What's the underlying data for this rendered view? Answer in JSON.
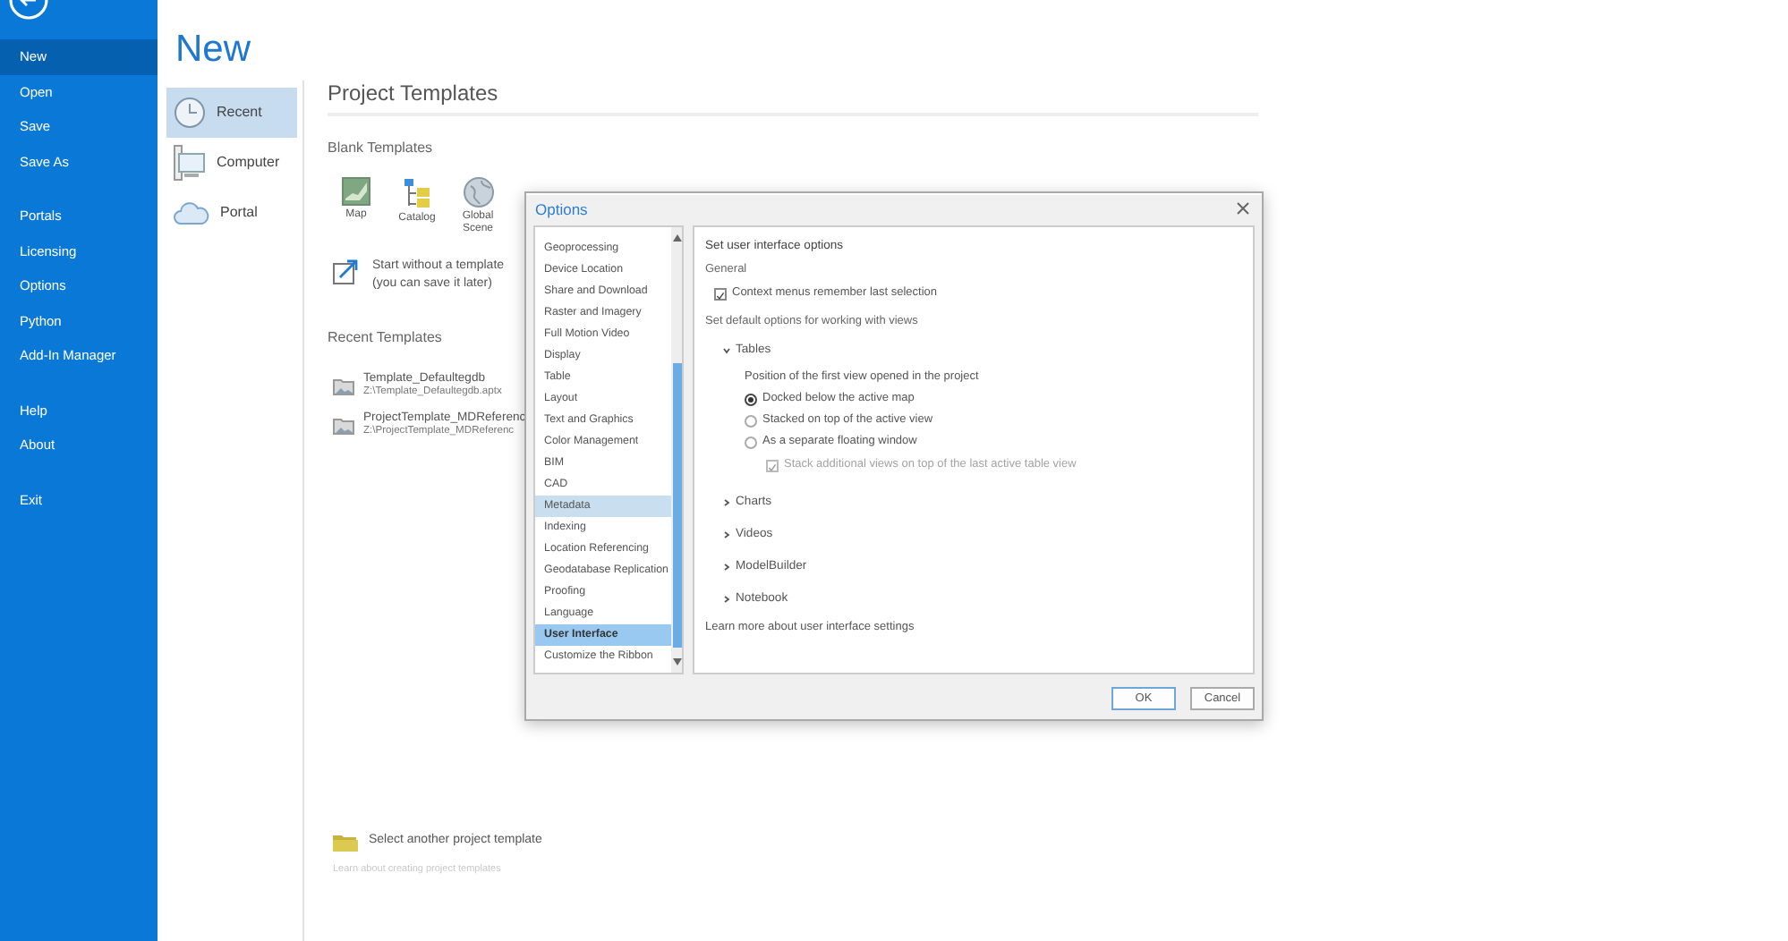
{
  "sidebar": {
    "groups": [
      [
        {
          "label": "New",
          "selected": true
        },
        {
          "label": "Open",
          "selected": false
        },
        {
          "label": "Save",
          "selected": false
        },
        {
          "label": "Save As",
          "selected": false
        }
      ],
      [
        {
          "label": "Portals",
          "selected": false
        },
        {
          "label": "Licensing",
          "selected": false
        },
        {
          "label": "Options",
          "selected": false
        },
        {
          "label": "Python",
          "selected": false
        },
        {
          "label": "Add-In Manager",
          "selected": false
        }
      ],
      [
        {
          "label": "Help",
          "selected": false
        },
        {
          "label": "About",
          "selected": false
        }
      ],
      [
        {
          "label": "Exit",
          "selected": false
        }
      ]
    ]
  },
  "page_title": "New",
  "locations": [
    {
      "label": "Recent",
      "kind": "clock",
      "selected": true
    },
    {
      "label": "Computer",
      "kind": "computer",
      "selected": false
    },
    {
      "label": "Portal",
      "kind": "cloud",
      "selected": false
    }
  ],
  "content": {
    "title": "Project Templates",
    "blank_templates": {
      "heading": "Blank Templates",
      "items": [
        {
          "label": "Map",
          "kind": "map"
        },
        {
          "label": "Catalog",
          "kind": "catalog"
        },
        {
          "label": "Global Scene",
          "kind": "globe"
        }
      ]
    },
    "start_without": [
      "Start without a template",
      "(you can save it later)"
    ],
    "recent_templates": {
      "heading": "Recent Templates",
      "items": [
        {
          "name": "Template_Defaultegdb",
          "path": "Z:\\Template_Defaultegdb.aptx"
        },
        {
          "name": "ProjectTemplate_MDReferenc",
          "path": "Z:\\ProjectTemplate_MDReferenc"
        }
      ]
    },
    "select_another": "Select another project template",
    "learn_link": "Learn about creating project templates"
  },
  "dialog": {
    "title": "Options",
    "categories": [
      {
        "label": "Geoprocessing",
        "selected": false,
        "highlighted": false
      },
      {
        "label": "Device Location",
        "selected": false,
        "highlighted": false
      },
      {
        "label": "Share and Download",
        "selected": false,
        "highlighted": false
      },
      {
        "label": "Raster and Imagery",
        "selected": false,
        "highlighted": false
      },
      {
        "label": "Full Motion Video",
        "selected": false,
        "highlighted": false
      },
      {
        "label": "Display",
        "selected": false,
        "highlighted": false
      },
      {
        "label": "Table",
        "selected": false,
        "highlighted": false
      },
      {
        "label": "Layout",
        "selected": false,
        "highlighted": false
      },
      {
        "label": "Text and Graphics",
        "selected": false,
        "highlighted": false
      },
      {
        "label": "Color Management",
        "selected": false,
        "highlighted": false
      },
      {
        "label": "BIM",
        "selected": false,
        "highlighted": false
      },
      {
        "label": "CAD",
        "selected": false,
        "highlighted": false
      },
      {
        "label": "Metadata",
        "selected": false,
        "highlighted": true
      },
      {
        "label": "Indexing",
        "selected": false,
        "highlighted": false
      },
      {
        "label": "Location Referencing",
        "selected": false,
        "highlighted": false
      },
      {
        "label": "Geodatabase Replication",
        "selected": false,
        "highlighted": false
      },
      {
        "label": "Proofing",
        "selected": false,
        "highlighted": false
      },
      {
        "label": "Language",
        "selected": false,
        "highlighted": false
      },
      {
        "label": "User Interface",
        "selected": true,
        "highlighted": false
      },
      {
        "label": "Customize the Ribbon",
        "selected": false,
        "highlighted": false
      }
    ],
    "panel": {
      "heading": "Set user interface options",
      "general_heading": "General",
      "general_option": {
        "label": "Context menus remember last selection",
        "checked": true
      },
      "views_heading": "Set default options for working with views",
      "sections": [
        {
          "label": "Tables",
          "expanded": true,
          "description": "Position of the first view opened in the project",
          "choices": [
            {
              "label": "Docked below the active map",
              "selected": true
            },
            {
              "label": "Stacked on top of the active view",
              "selected": false
            },
            {
              "label": "As a separate floating window",
              "selected": false
            }
          ],
          "sub_option": {
            "label": "Stack additional views on top of the last active table view",
            "checked": true,
            "disabled": true
          }
        },
        {
          "label": "Charts",
          "expanded": false
        },
        {
          "label": "Videos",
          "expanded": false
        },
        {
          "label": "ModelBuilder",
          "expanded": false
        },
        {
          "label": "Notebook",
          "expanded": false
        }
      ],
      "learn_link": "Learn more about user interface settings"
    },
    "buttons": [
      {
        "label": "OK",
        "kind": "primary"
      },
      {
        "label": "Cancel",
        "kind": "secondary"
      }
    ]
  }
}
